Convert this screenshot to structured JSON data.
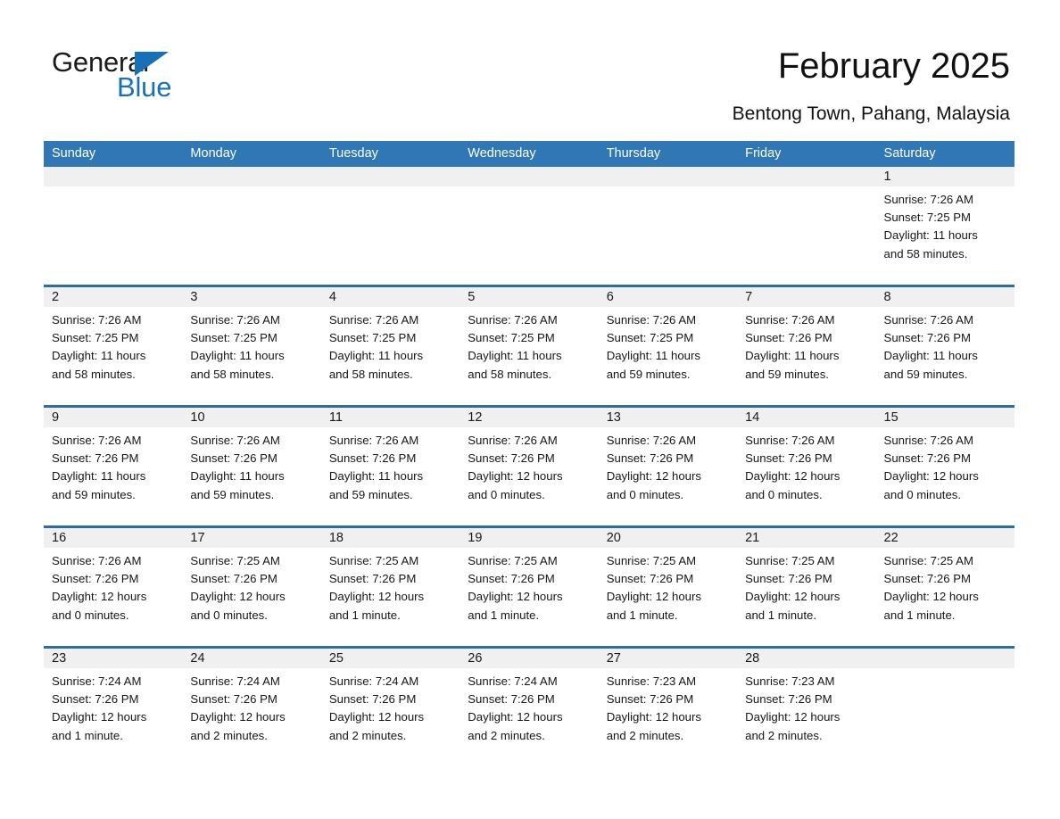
{
  "brand": {
    "name_part1": "General",
    "name_part2": "Blue",
    "accent_color": "#1771b8",
    "triangle_icon": "triangle-icon"
  },
  "header": {
    "title": "February 2025",
    "location": "Bentong Town, Pahang, Malaysia"
  },
  "calendar": {
    "header_bg": "#3077b5",
    "row_divider": "#2e6da4",
    "daynum_band_bg": "#f0f0f0",
    "weekdays": [
      "Sunday",
      "Monday",
      "Tuesday",
      "Wednesday",
      "Thursday",
      "Friday",
      "Saturday"
    ],
    "weeks": [
      [
        {
          "day": "",
          "lines": []
        },
        {
          "day": "",
          "lines": []
        },
        {
          "day": "",
          "lines": []
        },
        {
          "day": "",
          "lines": []
        },
        {
          "day": "",
          "lines": []
        },
        {
          "day": "",
          "lines": []
        },
        {
          "day": "1",
          "lines": [
            "Sunrise: 7:26 AM",
            "Sunset: 7:25 PM",
            "Daylight: 11 hours",
            "and 58 minutes."
          ]
        }
      ],
      [
        {
          "day": "2",
          "lines": [
            "Sunrise: 7:26 AM",
            "Sunset: 7:25 PM",
            "Daylight: 11 hours",
            "and 58 minutes."
          ]
        },
        {
          "day": "3",
          "lines": [
            "Sunrise: 7:26 AM",
            "Sunset: 7:25 PM",
            "Daylight: 11 hours",
            "and 58 minutes."
          ]
        },
        {
          "day": "4",
          "lines": [
            "Sunrise: 7:26 AM",
            "Sunset: 7:25 PM",
            "Daylight: 11 hours",
            "and 58 minutes."
          ]
        },
        {
          "day": "5",
          "lines": [
            "Sunrise: 7:26 AM",
            "Sunset: 7:25 PM",
            "Daylight: 11 hours",
            "and 58 minutes."
          ]
        },
        {
          "day": "6",
          "lines": [
            "Sunrise: 7:26 AM",
            "Sunset: 7:25 PM",
            "Daylight: 11 hours",
            "and 59 minutes."
          ]
        },
        {
          "day": "7",
          "lines": [
            "Sunrise: 7:26 AM",
            "Sunset: 7:26 PM",
            "Daylight: 11 hours",
            "and 59 minutes."
          ]
        },
        {
          "day": "8",
          "lines": [
            "Sunrise: 7:26 AM",
            "Sunset: 7:26 PM",
            "Daylight: 11 hours",
            "and 59 minutes."
          ]
        }
      ],
      [
        {
          "day": "9",
          "lines": [
            "Sunrise: 7:26 AM",
            "Sunset: 7:26 PM",
            "Daylight: 11 hours",
            "and 59 minutes."
          ]
        },
        {
          "day": "10",
          "lines": [
            "Sunrise: 7:26 AM",
            "Sunset: 7:26 PM",
            "Daylight: 11 hours",
            "and 59 minutes."
          ]
        },
        {
          "day": "11",
          "lines": [
            "Sunrise: 7:26 AM",
            "Sunset: 7:26 PM",
            "Daylight: 11 hours",
            "and 59 minutes."
          ]
        },
        {
          "day": "12",
          "lines": [
            "Sunrise: 7:26 AM",
            "Sunset: 7:26 PM",
            "Daylight: 12 hours",
            "and 0 minutes."
          ]
        },
        {
          "day": "13",
          "lines": [
            "Sunrise: 7:26 AM",
            "Sunset: 7:26 PM",
            "Daylight: 12 hours",
            "and 0 minutes."
          ]
        },
        {
          "day": "14",
          "lines": [
            "Sunrise: 7:26 AM",
            "Sunset: 7:26 PM",
            "Daylight: 12 hours",
            "and 0 minutes."
          ]
        },
        {
          "day": "15",
          "lines": [
            "Sunrise: 7:26 AM",
            "Sunset: 7:26 PM",
            "Daylight: 12 hours",
            "and 0 minutes."
          ]
        }
      ],
      [
        {
          "day": "16",
          "lines": [
            "Sunrise: 7:26 AM",
            "Sunset: 7:26 PM",
            "Daylight: 12 hours",
            "and 0 minutes."
          ]
        },
        {
          "day": "17",
          "lines": [
            "Sunrise: 7:25 AM",
            "Sunset: 7:26 PM",
            "Daylight: 12 hours",
            "and 0 minutes."
          ]
        },
        {
          "day": "18",
          "lines": [
            "Sunrise: 7:25 AM",
            "Sunset: 7:26 PM",
            "Daylight: 12 hours",
            "and 1 minute."
          ]
        },
        {
          "day": "19",
          "lines": [
            "Sunrise: 7:25 AM",
            "Sunset: 7:26 PM",
            "Daylight: 12 hours",
            "and 1 minute."
          ]
        },
        {
          "day": "20",
          "lines": [
            "Sunrise: 7:25 AM",
            "Sunset: 7:26 PM",
            "Daylight: 12 hours",
            "and 1 minute."
          ]
        },
        {
          "day": "21",
          "lines": [
            "Sunrise: 7:25 AM",
            "Sunset: 7:26 PM",
            "Daylight: 12 hours",
            "and 1 minute."
          ]
        },
        {
          "day": "22",
          "lines": [
            "Sunrise: 7:25 AM",
            "Sunset: 7:26 PM",
            "Daylight: 12 hours",
            "and 1 minute."
          ]
        }
      ],
      [
        {
          "day": "23",
          "lines": [
            "Sunrise: 7:24 AM",
            "Sunset: 7:26 PM",
            "Daylight: 12 hours",
            "and 1 minute."
          ]
        },
        {
          "day": "24",
          "lines": [
            "Sunrise: 7:24 AM",
            "Sunset: 7:26 PM",
            "Daylight: 12 hours",
            "and 2 minutes."
          ]
        },
        {
          "day": "25",
          "lines": [
            "Sunrise: 7:24 AM",
            "Sunset: 7:26 PM",
            "Daylight: 12 hours",
            "and 2 minutes."
          ]
        },
        {
          "day": "26",
          "lines": [
            "Sunrise: 7:24 AM",
            "Sunset: 7:26 PM",
            "Daylight: 12 hours",
            "and 2 minutes."
          ]
        },
        {
          "day": "27",
          "lines": [
            "Sunrise: 7:23 AM",
            "Sunset: 7:26 PM",
            "Daylight: 12 hours",
            "and 2 minutes."
          ]
        },
        {
          "day": "28",
          "lines": [
            "Sunrise: 7:23 AM",
            "Sunset: 7:26 PM",
            "Daylight: 12 hours",
            "and 2 minutes."
          ]
        },
        {
          "day": "",
          "lines": []
        }
      ]
    ]
  }
}
